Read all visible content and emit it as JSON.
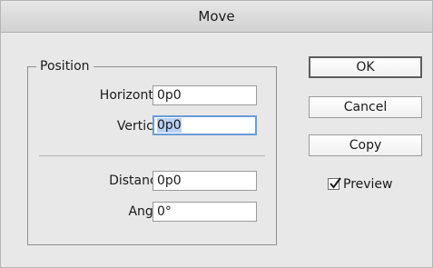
{
  "window": {
    "title": "Move"
  },
  "position_group": {
    "legend": "Position",
    "horizontal": {
      "label": "Horizontal:",
      "value": "0p0"
    },
    "vertical": {
      "label": "Vertical:",
      "value": "0p0"
    },
    "distance": {
      "label": "Distance:",
      "value": "0p0"
    },
    "angle": {
      "label": "Angle:",
      "value": "0°"
    }
  },
  "buttons": {
    "ok": "OK",
    "cancel": "Cancel",
    "copy": "Copy"
  },
  "preview": {
    "label": "Preview",
    "checked": true
  },
  "colors": {
    "focus_ring": "#6a9bd6",
    "selection": "#b7d2f5"
  }
}
